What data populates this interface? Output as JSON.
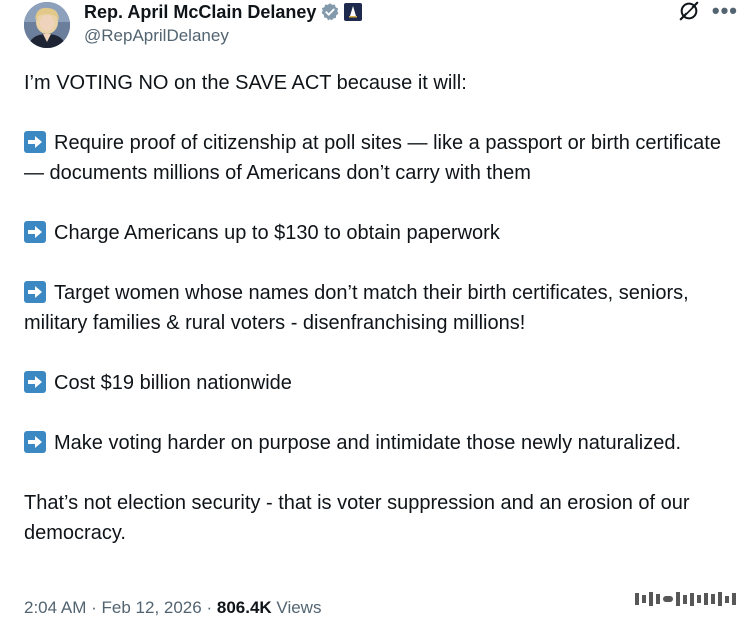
{
  "header": {
    "display_name": "Rep. April McClain Delaney",
    "handle": "@RepAprilDelaney",
    "verified_icon": "verified-badge-icon",
    "affiliate_icon": "government-affiliate-icon",
    "colors": {
      "verified": "#829aab",
      "affiliate_bg": "#1d2a4d"
    }
  },
  "actions": {
    "grok_icon": "grok-icon",
    "more_label": "•••"
  },
  "tweet": {
    "intro": "I’m VOTING NO on the SAVE ACT because it will:",
    "points": [
      "Require proof of citizenship at poll sites  — like a passport or birth certificate — documents millions of Americans don’t carry with them",
      "Charge Americans up to $130 to obtain paperwork",
      "Target women whose names don’t match their birth certificates, seniors, military families & rural voters - disenfranchising millions!",
      "Cost $19 billion nationwide",
      "Make voting harder on purpose and intimidate those newly naturalized."
    ],
    "conclusion": "That’s not election security - that is voter suppression and an erosion of our democracy.",
    "bullet_icon": "right-arrow-emoji-icon",
    "bullet_color": "#3b88c3"
  },
  "meta": {
    "time": "2:04 AM",
    "separator": "·",
    "date": "Feb 12, 2026",
    "views_count": "806.4K",
    "views_label": "Views"
  }
}
